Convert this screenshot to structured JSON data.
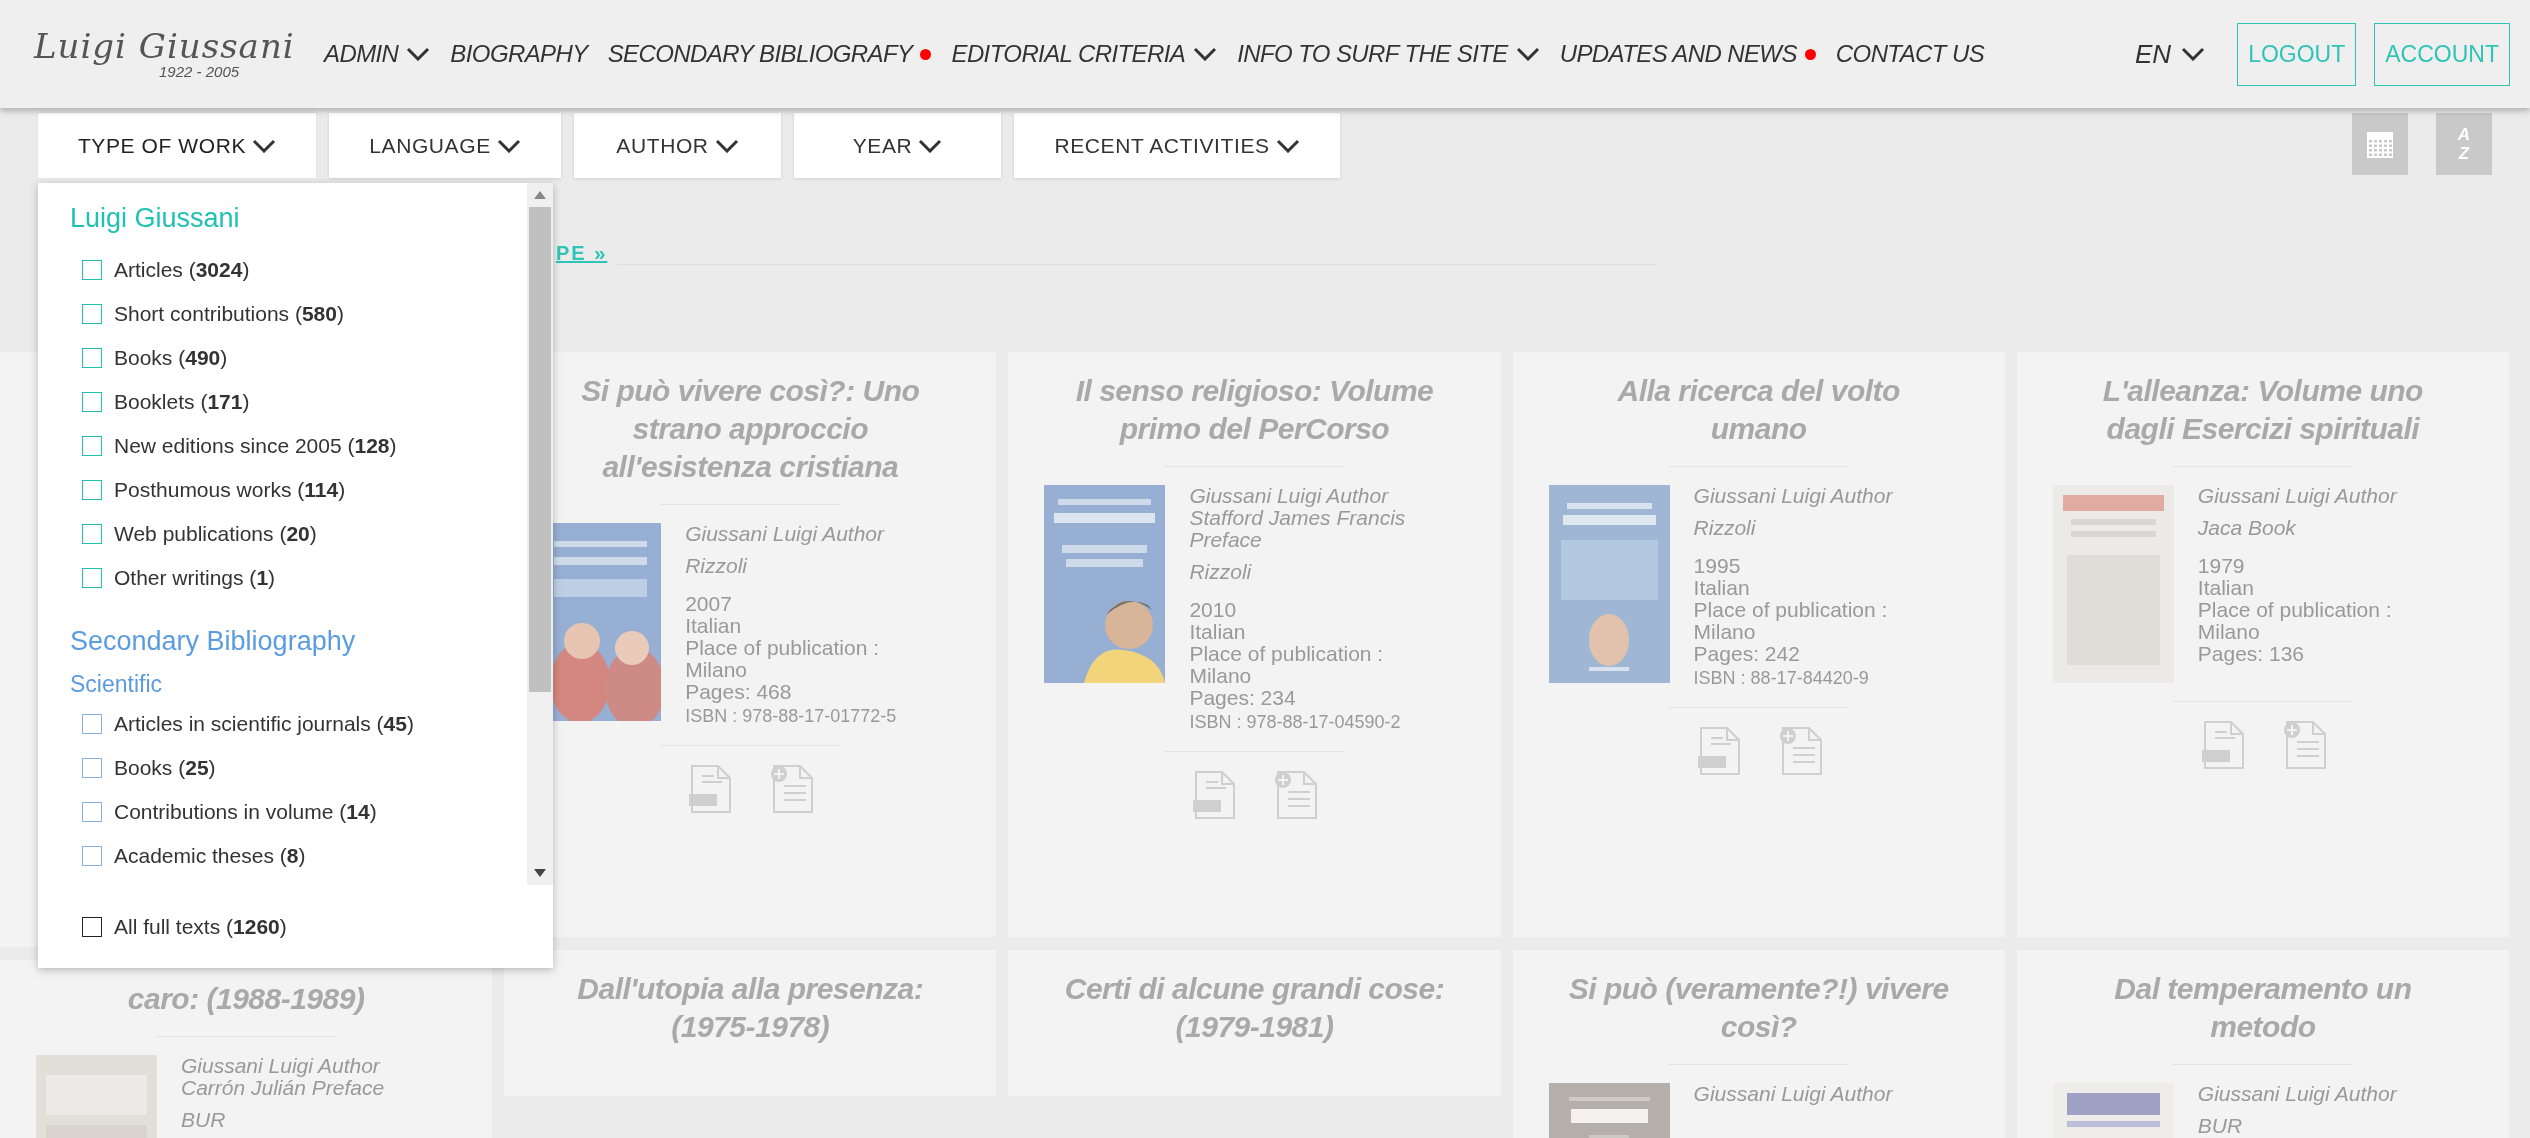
{
  "logo": {
    "signature": "Luigi Giussani",
    "years": "1922 - 2005"
  },
  "nav": [
    {
      "label": "ADMIN",
      "dropdown": true,
      "dot": false
    },
    {
      "label": "BIOGRAPHY",
      "dropdown": false,
      "dot": false
    },
    {
      "label": "SECONDARY BIBLIOGRAFY",
      "dropdown": false,
      "dot": true
    },
    {
      "label": "EDITORIAL CRITERIA",
      "dropdown": true,
      "dot": false
    },
    {
      "label": "INFO TO SURF THE SITE",
      "dropdown": true,
      "dot": false
    },
    {
      "label": "UPDATES AND NEWS",
      "dropdown": false,
      "dot": true
    },
    {
      "label": "CONTACT US",
      "dropdown": false,
      "dot": false
    }
  ],
  "language": "EN",
  "account_buttons": [
    "LOGOUT",
    "ACCOUNT"
  ],
  "filters": [
    {
      "label": "TYPE OF WORK",
      "expanded": true
    },
    {
      "label": "LANGUAGE",
      "expanded": false
    },
    {
      "label": "AUTHOR",
      "expanded": false
    },
    {
      "label": "YEAR",
      "expanded": false
    },
    {
      "label": "RECENT ACTIVITIES",
      "expanded": false
    }
  ],
  "sort_button": {
    "lines": [
      "A",
      "Z"
    ]
  },
  "link": "PE »",
  "dropdown": {
    "sections": [
      {
        "kind": "primary",
        "heading": "Luigi Giussani",
        "items": [
          {
            "label": "Articles (**3024**)",
            "checked": false
          },
          {
            "label": "Short contributions (**580**)",
            "checked": false
          },
          {
            "label": "Books (**490**)",
            "checked": false
          },
          {
            "label": "Booklets (**171**)",
            "checked": false
          },
          {
            "label": "New editions since 2005 (**128**)",
            "checked": false
          },
          {
            "label": "Posthumous works (**114**)",
            "checked": false
          },
          {
            "label": "Web publications (**20**)",
            "checked": false
          },
          {
            "label": "Other writings (**1**)",
            "checked": false
          }
        ]
      },
      {
        "kind": "secondary",
        "heading": "Secondary Bibliography",
        "subheading": "Scientific",
        "items": [
          {
            "label": "Articles in scientific journals (**45**)",
            "checked": false
          },
          {
            "label": "Books (**25**)",
            "checked": false
          },
          {
            "label": "Contributions in volume (**14**)",
            "checked": false
          },
          {
            "label": "Academic theses  (**8**)",
            "checked": false
          }
        ]
      }
    ],
    "footer_item": {
      "label": "All full texts (**1260**)",
      "checked": false
    }
  },
  "columns": [
    {
      "cards": [
        {
          "kind": "covered"
        },
        {
          "kind": "book",
          "title": "caro: (1988-1989)",
          "cover": {
            "kind": "picture"
          },
          "authors": [
            "Giussani Luigi Author",
            "Carrón Julián Preface"
          ],
          "publisher": "BUR"
        }
      ]
    },
    {
      "cards": [
        {
          "kind": "book",
          "title": "Si può vivere così?: Uno strano approccio all'esistenza cristiana",
          "cover": {
            "kind": "picture"
          },
          "authors": [
            "Giussani Luigi Author"
          ],
          "publisher": "Rizzoli",
          "details": [
            "2007",
            "Italian",
            "Place of publication : Milano",
            "Pages: 468"
          ],
          "isbn": "ISBN : 978-88-17-01772-5",
          "actions": [
            {
              "kind": "pdf"
            },
            {
              "kind": "add"
            }
          ]
        },
        {
          "kind": "book",
          "title": "Dall'utopia alla presenza: (1975-1978)"
        }
      ]
    },
    {
      "cards": [
        {
          "kind": "book",
          "title": "Il senso religioso: Volume primo del PerCorso",
          "cover": {
            "kind": "picture"
          },
          "authors": [
            "Giussani Luigi Author",
            "Stafford James Francis Preface"
          ],
          "publisher": "Rizzoli",
          "details": [
            "2010",
            "Italian",
            "Place of publication : Milano",
            "Pages: 234"
          ],
          "isbn": "ISBN : 978-88-17-04590-2",
          "actions": [
            {
              "kind": "pdf"
            },
            {
              "kind": "add"
            }
          ]
        },
        {
          "kind": "book",
          "title": "Certi di alcune grandi cose: (1979-1981)"
        }
      ]
    },
    {
      "cards": [
        {
          "kind": "book",
          "title": "Alla ricerca del volto umano",
          "cover": {
            "kind": "picture"
          },
          "authors": [
            "Giussani Luigi Author"
          ],
          "publisher": "Rizzoli",
          "details": [
            "1995",
            "Italian",
            "Place of publication : Milano",
            "Pages: 242"
          ],
          "isbn": "ISBN : 88-17-84420-9",
          "actions": [
            {
              "kind": "pdf"
            },
            {
              "kind": "add"
            }
          ]
        },
        {
          "kind": "book",
          "title": "Si può (veramente?!) vivere così?",
          "cover": {
            "kind": "picture"
          },
          "authors": [
            "Giussani Luigi Author"
          ]
        }
      ]
    },
    {
      "cards": [
        {
          "kind": "book",
          "title": "L'alleanza: Volume uno dagli Esercizi spirituali",
          "cover": {
            "kind": "picture"
          },
          "authors": [
            "Giussani Luigi Author"
          ],
          "publisher": "Jaca Book",
          "details": [
            "1979",
            "Italian",
            "Place of publication : Milano",
            "Pages: 136"
          ],
          "actions": [
            {
              "kind": "pdf"
            },
            {
              "kind": "add"
            }
          ]
        },
        {
          "kind": "book",
          "title": "Dal temperamento un metodo",
          "cover": {
            "kind": "picture"
          },
          "authors": [
            "Giussani Luigi Author"
          ],
          "publisher": "BUR"
        }
      ]
    }
  ]
}
